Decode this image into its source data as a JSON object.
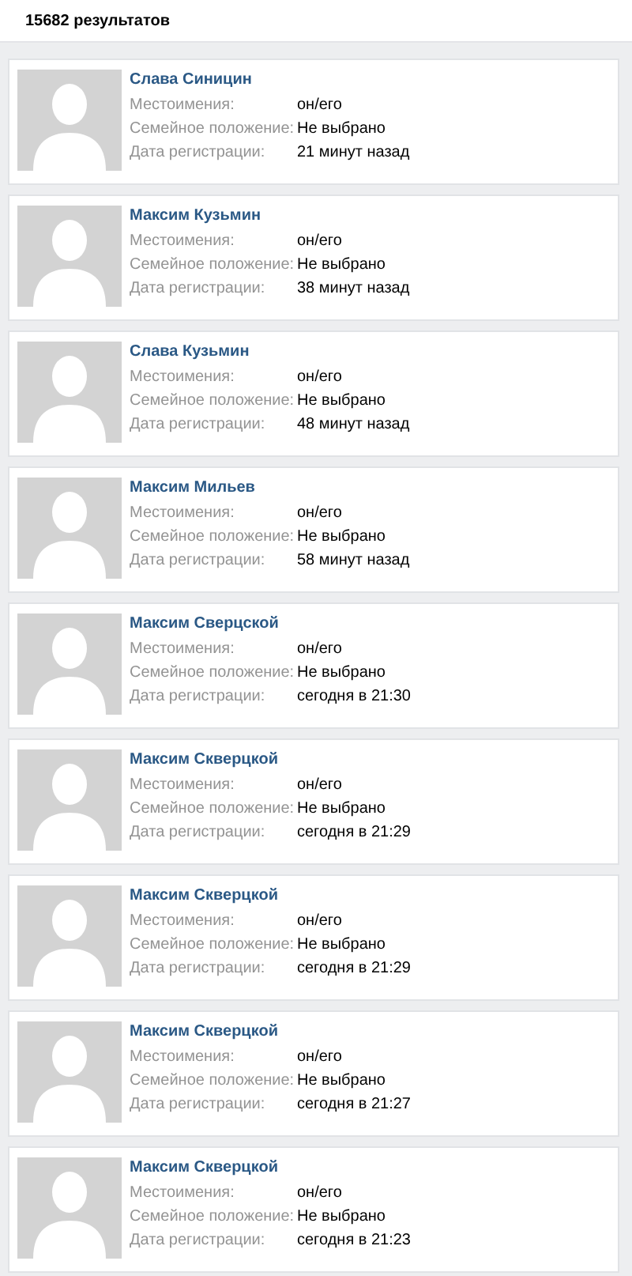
{
  "results_count": "15682 результатов",
  "people": [
    {
      "name": "Слава Синицин",
      "fields": [
        {
          "label": "Местоимения:",
          "value": "он/его"
        },
        {
          "label": "Семейное положение:",
          "value": "Не выбрано"
        },
        {
          "label": "Дата регистрации:",
          "value": "21 минут назад"
        }
      ]
    },
    {
      "name": "Максим Кузьмин",
      "fields": [
        {
          "label": "Местоимения:",
          "value": "он/его"
        },
        {
          "label": "Семейное положение:",
          "value": "Не выбрано"
        },
        {
          "label": "Дата регистрации:",
          "value": "38 минут назад"
        }
      ]
    },
    {
      "name": "Слава Кузьмин",
      "fields": [
        {
          "label": "Местоимения:",
          "value": "он/его"
        },
        {
          "label": "Семейное положение:",
          "value": "Не выбрано"
        },
        {
          "label": "Дата регистрации:",
          "value": "48 минут назад"
        }
      ]
    },
    {
      "name": "Максим Мильев",
      "fields": [
        {
          "label": "Местоимения:",
          "value": "он/его"
        },
        {
          "label": "Семейное положение:",
          "value": "Не выбрано"
        },
        {
          "label": "Дата регистрации:",
          "value": "58 минут назад"
        }
      ]
    },
    {
      "name": "Максим Сверцской",
      "fields": [
        {
          "label": "Местоимения:",
          "value": "он/его"
        },
        {
          "label": "Семейное положение:",
          "value": "Не выбрано"
        },
        {
          "label": "Дата регистрации:",
          "value": "сегодня в 21:30"
        }
      ]
    },
    {
      "name": "Максим Скверцкой",
      "fields": [
        {
          "label": "Местоимения:",
          "value": "он/его"
        },
        {
          "label": "Семейное положение:",
          "value": "Не выбрано"
        },
        {
          "label": "Дата регистрации:",
          "value": "сегодня в 21:29"
        }
      ]
    },
    {
      "name": "Максим Скверцкой",
      "fields": [
        {
          "label": "Местоимения:",
          "value": "он/его"
        },
        {
          "label": "Семейное положение:",
          "value": "Не выбрано"
        },
        {
          "label": "Дата регистрации:",
          "value": "сегодня в 21:29"
        }
      ]
    },
    {
      "name": "Максим Скверцкой",
      "fields": [
        {
          "label": "Местоимения:",
          "value": "он/его"
        },
        {
          "label": "Семейное положение:",
          "value": "Не выбрано"
        },
        {
          "label": "Дата регистрации:",
          "value": "сегодня в 21:27"
        }
      ]
    },
    {
      "name": "Максим Скверцкой",
      "fields": [
        {
          "label": "Местоимения:",
          "value": "он/его"
        },
        {
          "label": "Семейное положение:",
          "value": "Не выбрано"
        },
        {
          "label": "Дата регистрации:",
          "value": "сегодня в 21:23"
        }
      ]
    }
  ]
}
